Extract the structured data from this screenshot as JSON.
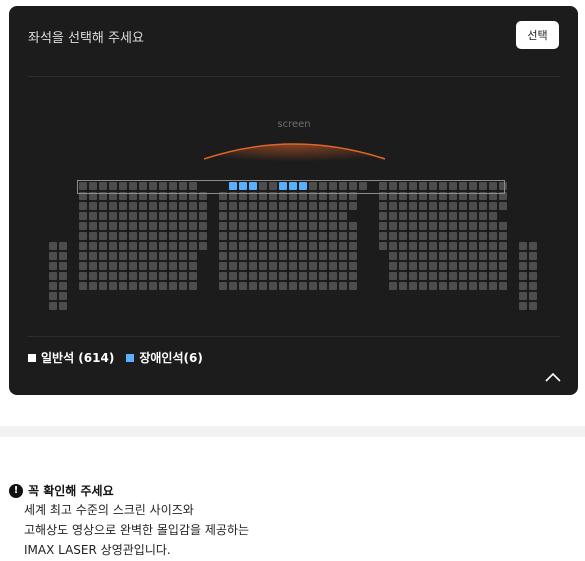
{
  "header": {
    "title": "좌석을 선택해 주세요",
    "select_button": "선택"
  },
  "screen": {
    "label": "screen"
  },
  "legend": {
    "items": [
      {
        "label": "일반석 (614)",
        "color": "#ffffff"
      },
      {
        "label": "장애인석(6)",
        "color": "#5ab0ff"
      }
    ]
  },
  "seat_colors": {
    "normal": "#4d4d4d",
    "accessible": "#5ab0ff"
  },
  "notice": {
    "title": "꼭 확인해 주세요",
    "lines": [
      "세계 최고 수준의 스크린 사이즈와",
      "고해상도 영상으로 완벽한 몰입감을 제공하는",
      "IMAX LASER 상영관입니다."
    ]
  }
}
